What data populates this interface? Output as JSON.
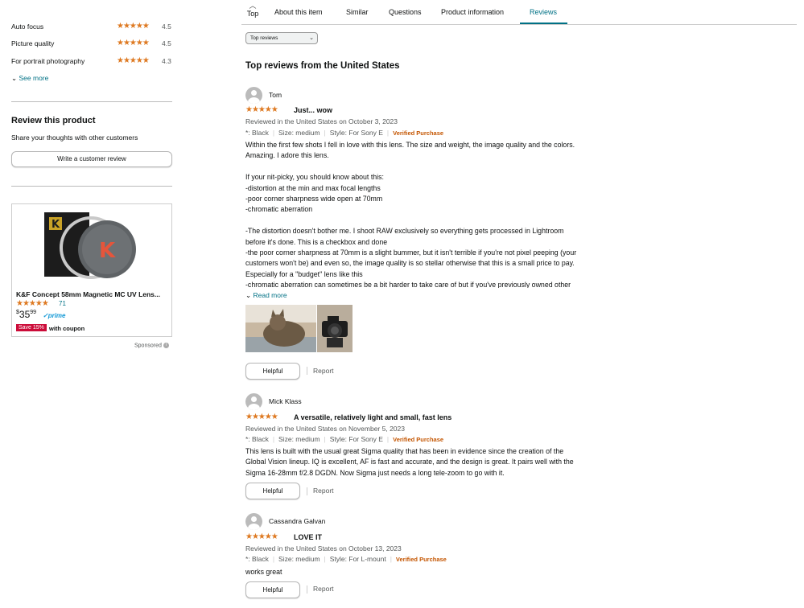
{
  "nav": {
    "top_label": "Top",
    "tabs": [
      "About this item",
      "Similar",
      "Questions",
      "Product information",
      "Reviews"
    ],
    "active_tab": "Reviews"
  },
  "ratings": [
    {
      "label": "Auto focus",
      "stars": "★★★★★",
      "value": "4.5"
    },
    {
      "label": "Picture quality",
      "stars": "★★★★★",
      "value": "4.5"
    },
    {
      "label": "For portrait photography",
      "stars": "★★★★★",
      "value": "4.3"
    }
  ],
  "see_more": "See more",
  "review_product": {
    "title": "Review this product",
    "subtitle": "Share your thoughts with other customers",
    "button": "Write a customer review"
  },
  "ad": {
    "title": "K&F Concept 58mm Magnetic MC UV Lens...",
    "stars": "★★★★★",
    "rating_count": "71",
    "price_dollars": "35",
    "price_cents": "99",
    "prime": "prime",
    "badge": "Save 15%",
    "coupon": "with coupon",
    "sponsored": "Sponsored"
  },
  "sort": {
    "selected": "Top reviews"
  },
  "section_title": "Top reviews from the United States",
  "reviews": [
    {
      "name": "Tom",
      "stars": "★★★★★",
      "title": "Just... wow",
      "meta": "Reviewed in the United States on October 3, 2023",
      "color": "*: Black",
      "size": "Size: medium",
      "style": "Style: For Sony E",
      "verified": "Verified Purchase",
      "body": [
        "Within the first few shots I fell in love with this lens. The size and weight, the image quality and the colors.",
        "Amazing. I adore this lens.",
        "",
        "If your nit-picky, you should know about this:",
        "-distortion at the min and max focal lengths",
        "-poor corner sharpness wide open at 70mm",
        "-chromatic aberration",
        "",
        "-The distortion doesn't bother me. I shoot RAW exclusively so everything gets processed in Lightroom",
        "before it's done. This is a checkbox and done",
        "-the poor corner sharpness at 70mm is a slight bummer, but it isn't terrible if you're not pixel peeping (your",
        "customers won't be) and even so, the image quality is so stellar otherwise that this is a small price to pay.",
        "Especially for a \"budget\" lens like this",
        "-chromatic aberration can sometimes be a bit harder to take care of but if you've previously owned other"
      ],
      "read_more": "Read more",
      "helpful": "Helpful",
      "report": "Report"
    },
    {
      "name": "Mick Klass",
      "stars": "★★★★★",
      "title": "A versatile, relatively light and small, fast lens",
      "meta": "Reviewed in the United States on November 5, 2023",
      "color": "*: Black",
      "size": "Size: medium",
      "style": "Style: For Sony E",
      "verified": "Verified Purchase",
      "body": [
        "This lens is built with the usual great Sigma quality that has been in evidence since the creation of the",
        "Global Vision lineup. IQ is excellent, AF is fast and accurate, and the design is great. It pairs well with the",
        "Sigma 16-28mm f/2.8 DGDN. Now Sigma just needs a long tele-zoom to go with it."
      ],
      "helpful": "Helpful",
      "report": "Report"
    },
    {
      "name": "Cassandra Galvan",
      "stars": "★★★★★",
      "title": "LOVE IT",
      "meta": "Reviewed in the United States on October 13, 2023",
      "color": "*: Black",
      "size": "Size: medium",
      "style": "Style: For L-mount",
      "verified": "Verified Purchase",
      "body": [
        "works great"
      ],
      "helpful": "Helpful",
      "report": "Report"
    }
  ],
  "colors": {
    "link": "#007185",
    "star": "#de7921",
    "verified": "#c45500",
    "deal": "#cc0c39"
  }
}
